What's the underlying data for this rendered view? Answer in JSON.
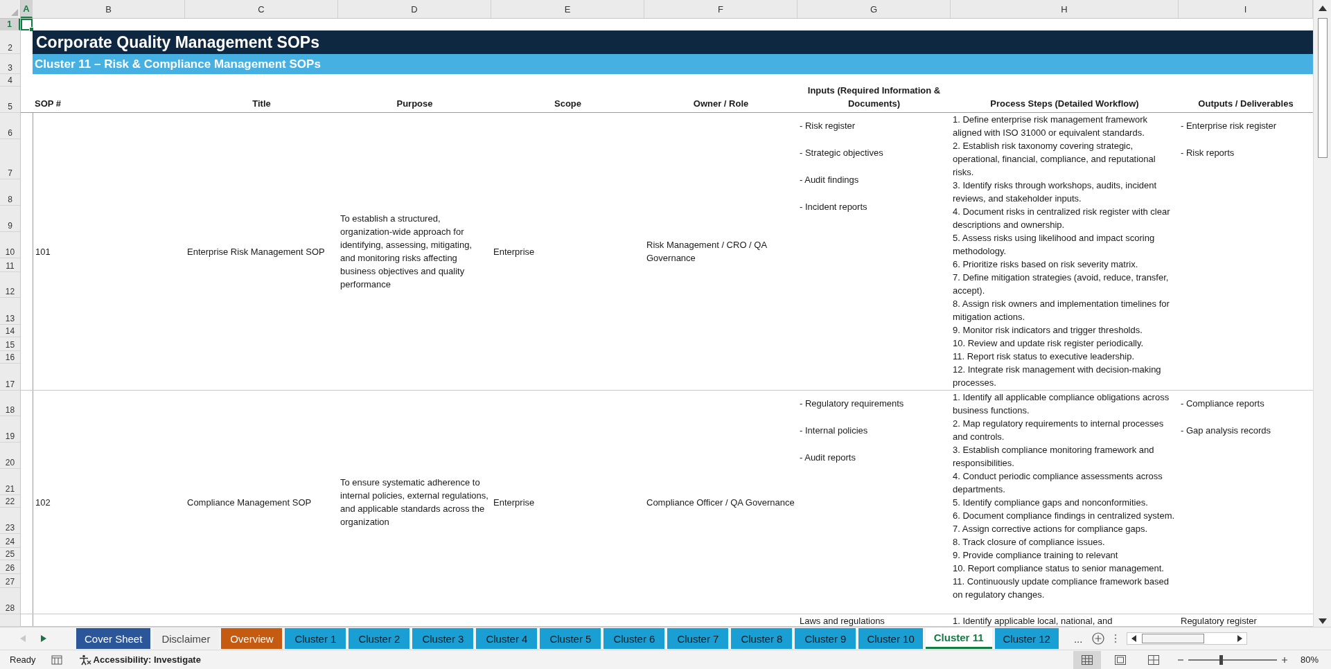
{
  "workbook": {
    "column_headers": [
      {
        "label": "A",
        "selected": true
      },
      {
        "label": "B",
        "selected": false
      },
      {
        "label": "C",
        "selected": false
      },
      {
        "label": "D",
        "selected": false
      },
      {
        "label": "E",
        "selected": false
      },
      {
        "label": "F",
        "selected": false
      },
      {
        "label": "G",
        "selected": false
      },
      {
        "label": "H",
        "selected": false
      },
      {
        "label": "I",
        "selected": false
      }
    ],
    "row_numbers": [
      {
        "label": "1",
        "selected": true
      },
      {
        "label": "2",
        "selected": false
      },
      {
        "label": "3",
        "selected": false
      },
      {
        "label": "4",
        "selected": false
      },
      {
        "label": "5",
        "selected": false
      },
      {
        "label": "6",
        "selected": false
      },
      {
        "label": "7",
        "selected": false
      },
      {
        "label": "8",
        "selected": false
      },
      {
        "label": "9",
        "selected": false
      },
      {
        "label": "10",
        "selected": false
      },
      {
        "label": "11",
        "selected": false
      },
      {
        "label": "12",
        "selected": false
      },
      {
        "label": "13",
        "selected": false
      },
      {
        "label": "14",
        "selected": false
      },
      {
        "label": "15",
        "selected": false
      },
      {
        "label": "16",
        "selected": false
      },
      {
        "label": "17",
        "selected": false
      },
      {
        "label": "18",
        "selected": false
      },
      {
        "label": "19",
        "selected": false
      },
      {
        "label": "20",
        "selected": false
      },
      {
        "label": "21",
        "selected": false
      },
      {
        "label": "22",
        "selected": false
      },
      {
        "label": "23",
        "selected": false
      },
      {
        "label": "24",
        "selected": false
      },
      {
        "label": "25",
        "selected": false
      },
      {
        "label": "26",
        "selected": false
      },
      {
        "label": "27",
        "selected": false
      },
      {
        "label": "28",
        "selected": false
      }
    ],
    "title": "Corporate Quality Management SOPs",
    "subtitle": "Cluster 11 – Risk & Compliance Management SOPs",
    "table": {
      "columns": [
        "SOP #",
        "Title",
        "Purpose",
        "Scope",
        "Owner / Role",
        "Inputs (Required Information & Documents)",
        "Process Steps (Detailed Workflow)",
        "Outputs / Deliverables"
      ],
      "rows": [
        {
          "sop": "101",
          "title": "Enterprise Risk Management SOP",
          "purpose": "To establish a structured, organization-wide approach for identifying, assessing, mitigating, and monitoring risks affecting business objectives and quality performance",
          "scope": "Enterprise",
          "owner": "Risk Management / CRO / QA Governance",
          "inputs": [
            "- Risk register",
            "- Strategic objectives",
            "- Audit findings",
            "- Incident reports"
          ],
          "steps": [
            "1. Define enterprise risk management framework aligned with ISO 31000 or equivalent standards.",
            "2. Establish risk taxonomy covering strategic, operational, financial, compliance, and reputational risks.",
            "3. Identify risks through workshops, audits, incident reviews, and stakeholder inputs.",
            "4. Document risks in centralized risk register with clear descriptions and ownership.",
            "5. Assess risks using likelihood and impact scoring methodology.",
            "6. Prioritize risks based on risk severity matrix.",
            "7. Define mitigation strategies (avoid, reduce, transfer, accept).",
            "8. Assign risk owners and implementation timelines for mitigation actions.",
            "9. Monitor risk indicators and trigger thresholds.",
            "10. Review and update risk register periodically.",
            "11. Report risk status to executive leadership.",
            "12. Integrate risk management with decision-making processes."
          ],
          "outputs": [
            "- Enterprise risk register",
            "- Risk reports"
          ]
        },
        {
          "sop": "102",
          "title": "Compliance Management SOP",
          "purpose": "To ensure systematic adherence to internal policies, external regulations, and applicable standards across the organization",
          "scope": "Enterprise",
          "owner": "Compliance Officer / QA Governance",
          "inputs": [
            "- Regulatory requirements",
            "- Internal policies",
            "- Audit reports"
          ],
          "steps": [
            "1. Identify all applicable compliance obligations across business functions.",
            "2. Map regulatory requirements to internal processes and controls.",
            "3. Establish compliance monitoring framework and responsibilities.",
            "4. Conduct periodic compliance assessments across departments.",
            "5. Identify compliance gaps and nonconformities.",
            "6. Document compliance findings in centralized system.",
            "7. Assign corrective actions for compliance gaps.",
            "8. Track closure of compliance issues.",
            "9. Provide compliance training to relevant",
            "10. Report compliance status to senior management.",
            "11. Continuously update compliance framework based on regulatory changes."
          ],
          "outputs": [
            "- Compliance reports",
            "- Gap analysis records"
          ]
        },
        {
          "inputs": [
            "Laws and regulations"
          ],
          "steps": [
            "1. Identify applicable local, national, and"
          ],
          "outputs": [
            "Regulatory register"
          ]
        }
      ]
    }
  },
  "sheet_tabs": [
    {
      "label": "Cover Sheet",
      "color": "#2b579a",
      "selected": false
    },
    {
      "label": "Disclaimer",
      "selected": false
    },
    {
      "label": "Overview",
      "color": "#c55a11",
      "selected": false
    },
    {
      "label": "Cluster 1",
      "color": "#1a9fd5",
      "selected": false
    },
    {
      "label": "Cluster 2",
      "color": "#1a9fd5",
      "selected": false
    },
    {
      "label": "Cluster 3",
      "color": "#1a9fd5",
      "selected": false
    },
    {
      "label": "Cluster 4",
      "color": "#1a9fd5",
      "selected": false
    },
    {
      "label": "Cluster 5",
      "color": "#1a9fd5",
      "selected": false
    },
    {
      "label": "Cluster 6",
      "color": "#1a9fd5",
      "selected": false
    },
    {
      "label": "Cluster 7",
      "color": "#1a9fd5",
      "selected": false
    },
    {
      "label": "Cluster 8",
      "color": "#1a9fd5",
      "selected": false
    },
    {
      "label": "Cluster 9",
      "color": "#1a9fd5",
      "selected": false
    },
    {
      "label": "Cluster 10",
      "color": "#1a9fd5",
      "selected": false
    },
    {
      "label": "Cluster 11",
      "selected": true
    },
    {
      "label": "Cluster 12",
      "color": "#1a9fd5",
      "selected": false
    }
  ],
  "more_tabs": "...",
  "status_bar": {
    "status": "Ready",
    "accessibility": "Accessibility: Investigate",
    "view_buttons": [
      {
        "selected": true
      },
      {
        "selected": false
      },
      {
        "selected": false
      }
    ],
    "zoom": {
      "level": 0.37,
      "reading": "80%"
    }
  }
}
